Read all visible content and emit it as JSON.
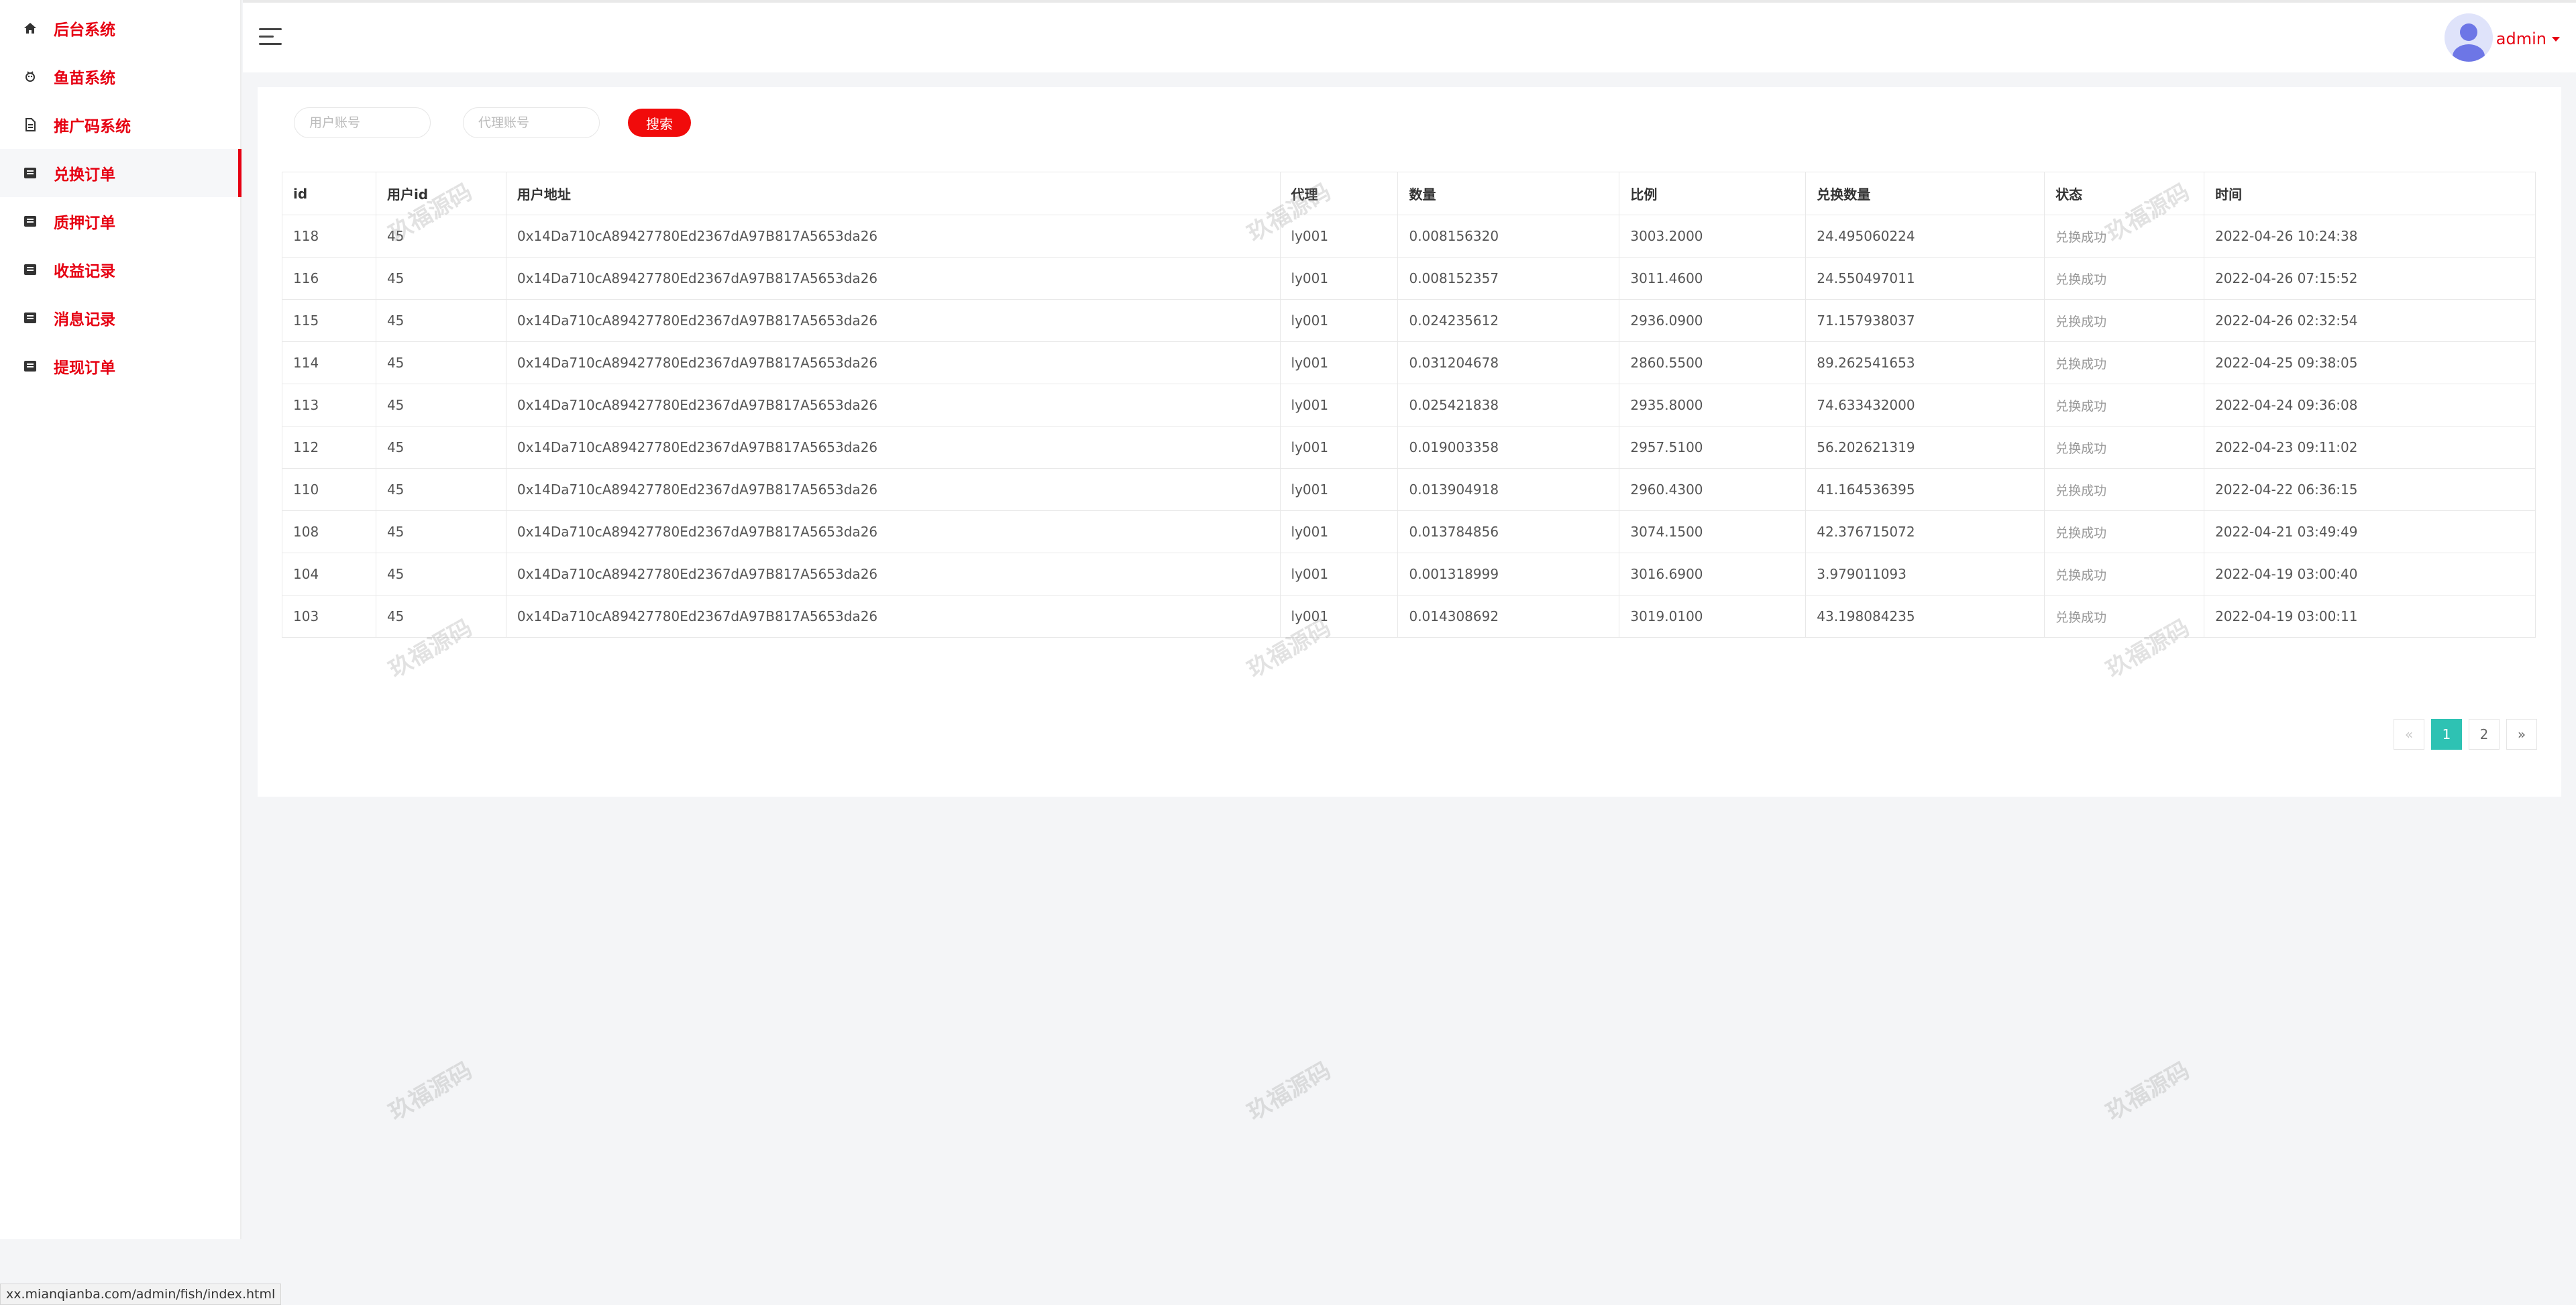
{
  "sidebar": {
    "items": [
      {
        "label": "后台系统",
        "icon": "home-icon"
      },
      {
        "label": "鱼苗系统",
        "icon": "fish-icon"
      },
      {
        "label": "推广码系统",
        "icon": "document-icon"
      },
      {
        "label": "兑换订单",
        "icon": "list-icon",
        "active": true
      },
      {
        "label": "质押订单",
        "icon": "list-icon"
      },
      {
        "label": "收益记录",
        "icon": "list-icon"
      },
      {
        "label": "消息记录",
        "icon": "list-icon"
      },
      {
        "label": "提现订单",
        "icon": "list-icon"
      }
    ]
  },
  "header": {
    "menu_icon": "hamburger-icon",
    "user_name": "admin",
    "avatar_icon": "user-avatar-icon"
  },
  "filters": {
    "user_account_placeholder": "用户账号",
    "agent_account_placeholder": "代理账号",
    "search_label": "搜索"
  },
  "table": {
    "columns": [
      "id",
      "用户id",
      "用户地址",
      "代理",
      "数量",
      "比例",
      "兑换数量",
      "状态",
      "时间"
    ],
    "rows": [
      [
        "118",
        "45",
        "0x14Da710cA89427780Ed2367dA97B817A5653da26",
        "ly001",
        "0.008156320",
        "3003.2000",
        "24.495060224",
        "兑换成功",
        "2022-04-26 10:24:38"
      ],
      [
        "116",
        "45",
        "0x14Da710cA89427780Ed2367dA97B817A5653da26",
        "ly001",
        "0.008152357",
        "3011.4600",
        "24.550497011",
        "兑换成功",
        "2022-04-26 07:15:52"
      ],
      [
        "115",
        "45",
        "0x14Da710cA89427780Ed2367dA97B817A5653da26",
        "ly001",
        "0.024235612",
        "2936.0900",
        "71.157938037",
        "兑换成功",
        "2022-04-26 02:32:54"
      ],
      [
        "114",
        "45",
        "0x14Da710cA89427780Ed2367dA97B817A5653da26",
        "ly001",
        "0.031204678",
        "2860.5500",
        "89.262541653",
        "兑换成功",
        "2022-04-25 09:38:05"
      ],
      [
        "113",
        "45",
        "0x14Da710cA89427780Ed2367dA97B817A5653da26",
        "ly001",
        "0.025421838",
        "2935.8000",
        "74.633432000",
        "兑换成功",
        "2022-04-24 09:36:08"
      ],
      [
        "112",
        "45",
        "0x14Da710cA89427780Ed2367dA97B817A5653da26",
        "ly001",
        "0.019003358",
        "2957.5100",
        "56.202621319",
        "兑换成功",
        "2022-04-23 09:11:02"
      ],
      [
        "110",
        "45",
        "0x14Da710cA89427780Ed2367dA97B817A5653da26",
        "ly001",
        "0.013904918",
        "2960.4300",
        "41.164536395",
        "兑换成功",
        "2022-04-22 06:36:15"
      ],
      [
        "108",
        "45",
        "0x14Da710cA89427780Ed2367dA97B817A5653da26",
        "ly001",
        "0.013784856",
        "3074.1500",
        "42.376715072",
        "兑换成功",
        "2022-04-21 03:49:49"
      ],
      [
        "104",
        "45",
        "0x14Da710cA89427780Ed2367dA97B817A5653da26",
        "ly001",
        "0.001318999",
        "3016.6900",
        "3.979011093",
        "兑换成功",
        "2022-04-19 03:00:40"
      ],
      [
        "103",
        "45",
        "0x14Da710cA89427780Ed2367dA97B817A5653da26",
        "ly001",
        "0.014308692",
        "3019.0100",
        "43.198084235",
        "兑换成功",
        "2022-04-19 03:00:11"
      ]
    ]
  },
  "pagination": {
    "prev": "«",
    "pages": [
      "1",
      "2"
    ],
    "current": "1",
    "next": "»"
  },
  "watermark_text": "玖福源码",
  "status_url": "xx.mianqianba.com/admin/fish/index.html",
  "colors": {
    "accent": "#e60012",
    "search_button": "#f10b0b",
    "active_page": "#2ec2b3"
  }
}
